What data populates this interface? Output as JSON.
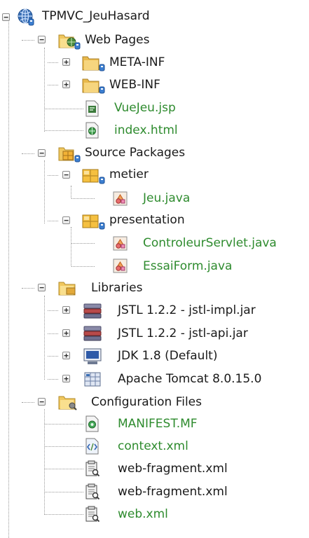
{
  "tree": {
    "nodes": [
      {
        "id": "n0",
        "label": "TPMVC_JeuHasard",
        "icon": "web-project-icon",
        "kind": "project",
        "depth": 0,
        "toggle": "expanded",
        "color": "#1a1a1a"
      },
      {
        "id": "n1",
        "label": "Web Pages",
        "icon": "web-pages-folder-icon",
        "kind": "folder",
        "depth": 1,
        "toggle": "expanded",
        "color": "#1a1a1a"
      },
      {
        "id": "n2",
        "label": "META-INF",
        "icon": "folder-icon",
        "kind": "folder",
        "depth": 2,
        "toggle": "collapsed",
        "color": "#1a1a1a"
      },
      {
        "id": "n3",
        "label": "WEB-INF",
        "icon": "folder-icon",
        "kind": "folder",
        "depth": 2,
        "toggle": "collapsed",
        "color": "#1a1a1a"
      },
      {
        "id": "n4",
        "label": "VueJeu.jsp",
        "icon": "jsp-file-icon",
        "kind": "file",
        "depth": 2,
        "toggle": "none",
        "color": "#2e8b2e"
      },
      {
        "id": "n5",
        "label": "index.html",
        "icon": "html-file-icon",
        "kind": "file",
        "depth": 2,
        "toggle": "none",
        "color": "#2e8b2e"
      },
      {
        "id": "n6",
        "label": "Source Packages",
        "icon": "source-packages-icon",
        "kind": "folder",
        "depth": 1,
        "toggle": "expanded",
        "color": "#1a1a1a"
      },
      {
        "id": "n7",
        "label": "metier",
        "icon": "package-icon",
        "kind": "package",
        "depth": 2,
        "toggle": "expanded",
        "color": "#1a1a1a"
      },
      {
        "id": "n8",
        "label": "Jeu.java",
        "icon": "java-class-icon",
        "kind": "file",
        "depth": 3,
        "toggle": "none",
        "color": "#2e8b2e"
      },
      {
        "id": "n9",
        "label": "presentation",
        "icon": "package-icon",
        "kind": "package",
        "depth": 2,
        "toggle": "expanded",
        "color": "#1a1a1a"
      },
      {
        "id": "n10",
        "label": "ControleurServlet.java",
        "icon": "java-class-icon",
        "kind": "file",
        "depth": 3,
        "toggle": "none",
        "color": "#2e8b2e"
      },
      {
        "id": "n11",
        "label": "EssaiForm.java",
        "icon": "java-class-icon",
        "kind": "file",
        "depth": 3,
        "toggle": "none",
        "color": "#2e8b2e"
      },
      {
        "id": "n12",
        "label": "Libraries",
        "icon": "libraries-folder-icon",
        "kind": "folder",
        "depth": 1,
        "toggle": "expanded",
        "color": "#1a1a1a"
      },
      {
        "id": "n13",
        "label": "JSTL 1.2.2 - jstl-impl.jar",
        "icon": "jar-library-icon",
        "kind": "library",
        "depth": 2,
        "toggle": "collapsed",
        "color": "#1a1a1a"
      },
      {
        "id": "n14",
        "label": "JSTL 1.2.2 - jstl-api.jar",
        "icon": "jar-library-icon",
        "kind": "library",
        "depth": 2,
        "toggle": "collapsed",
        "color": "#1a1a1a"
      },
      {
        "id": "n15",
        "label": "JDK 1.8 (Default)",
        "icon": "jdk-icon",
        "kind": "library",
        "depth": 2,
        "toggle": "collapsed",
        "color": "#1a1a1a"
      },
      {
        "id": "n16",
        "label": "Apache Tomcat 8.0.15.0",
        "icon": "server-library-icon",
        "kind": "library",
        "depth": 2,
        "toggle": "collapsed",
        "color": "#1a1a1a"
      },
      {
        "id": "n17",
        "label": "Configuration Files",
        "icon": "config-folder-icon",
        "kind": "folder",
        "depth": 1,
        "toggle": "expanded",
        "color": "#1a1a1a"
      },
      {
        "id": "n18",
        "label": "MANIFEST.MF",
        "icon": "manifest-file-icon",
        "kind": "file",
        "depth": 2,
        "toggle": "none",
        "color": "#2e8b2e"
      },
      {
        "id": "n19",
        "label": "context.xml",
        "icon": "xml-file-icon",
        "kind": "file",
        "depth": 2,
        "toggle": "none",
        "color": "#2e8b2e"
      },
      {
        "id": "n20",
        "label": "web-fragment.xml",
        "icon": "xml-descriptor-icon",
        "kind": "file",
        "depth": 2,
        "toggle": "none",
        "color": "#1a1a1a"
      },
      {
        "id": "n21",
        "label": "web-fragment.xml",
        "icon": "xml-descriptor-icon",
        "kind": "file",
        "depth": 2,
        "toggle": "none",
        "color": "#1a1a1a"
      },
      {
        "id": "n22",
        "label": "web.xml",
        "icon": "xml-descriptor-icon",
        "kind": "file",
        "depth": 2,
        "toggle": "none",
        "color": "#2e8b2e"
      }
    ]
  },
  "colors": {
    "versioned_text": "#2e8b2e",
    "plain_text": "#1a1a1a",
    "tree_lines": "#9a9a9a",
    "badge_blue": "#3d7fd0"
  }
}
